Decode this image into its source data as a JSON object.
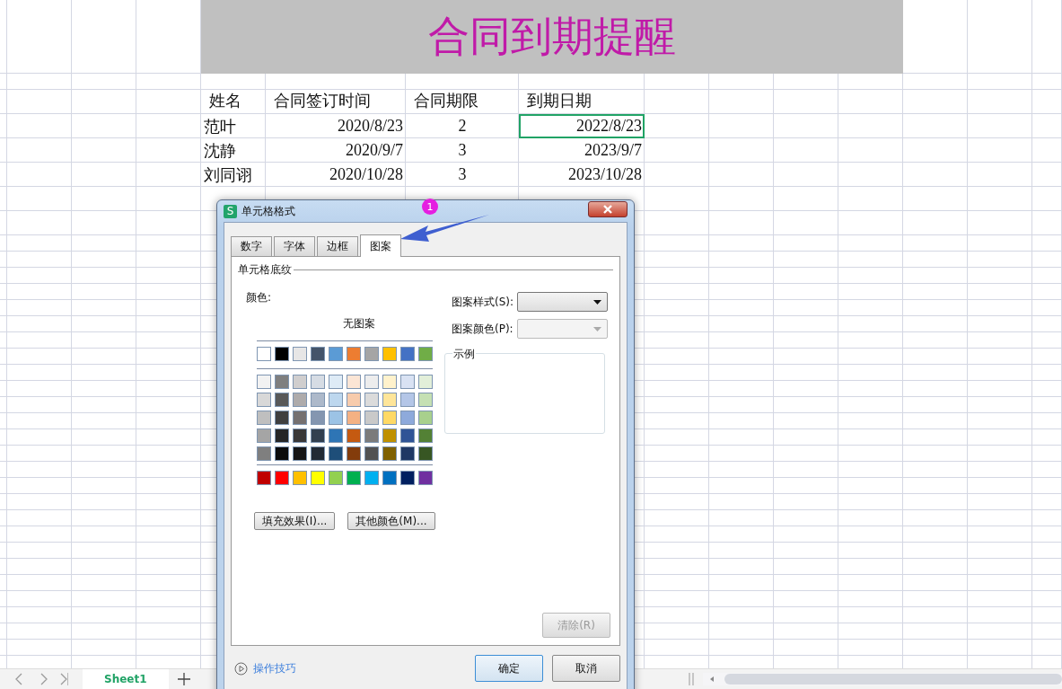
{
  "sheet": {
    "title": "合同到期提醒",
    "columns": [
      "姓名",
      "合同签订时间",
      "合同期限",
      "到期日期"
    ],
    "rows": [
      {
        "cells": [
          {
            "text": "范叶",
            "selected": false
          },
          {
            "text": "2020/8/23",
            "selected": false
          },
          {
            "text": "2",
            "selected": false
          },
          {
            "text": "2022/8/23",
            "selected": true
          }
        ]
      },
      {
        "cells": [
          {
            "text": "沈静",
            "selected": false
          },
          {
            "text": "2020/9/7",
            "selected": false
          },
          {
            "text": "3",
            "selected": false
          },
          {
            "text": "2023/9/7",
            "selected": false
          }
        ]
      },
      {
        "cells": [
          {
            "text": "刘同诩",
            "selected": false
          },
          {
            "text": "2020/10/28",
            "selected": false
          },
          {
            "text": "3",
            "selected": false
          },
          {
            "text": "2023/10/28",
            "selected": false
          }
        ]
      }
    ]
  },
  "sheet_tabs": [
    {
      "label": "Sheet1",
      "selected": true
    }
  ],
  "dialog": {
    "app_icon_letter": "S",
    "title": "单元格格式",
    "tabs": [
      {
        "label": "数字",
        "selected": false
      },
      {
        "label": "字体",
        "selected": false
      },
      {
        "label": "边框",
        "selected": false
      },
      {
        "label": "图案",
        "selected": true
      }
    ],
    "group_title": "单元格底纹",
    "color_label": "颜色:",
    "no_pattern": "无图案",
    "theme_colors": [
      {
        "color": "#ffffff"
      },
      {
        "color": "#000000"
      },
      {
        "color": "#e7e6e6"
      },
      {
        "color": "#44546a"
      },
      {
        "color": "#5b9bd5"
      },
      {
        "color": "#ed7d31"
      },
      {
        "color": "#a5a5a5"
      },
      {
        "color": "#ffc000"
      },
      {
        "color": "#4472c4"
      },
      {
        "color": "#70ad47"
      }
    ],
    "shade_rows": [
      [
        {
          "color": "#f2f2f2"
        },
        {
          "color": "#7f7f7f"
        },
        {
          "color": "#d0cece"
        },
        {
          "color": "#d6dce4"
        },
        {
          "color": "#deebf6"
        },
        {
          "color": "#fbe5d5"
        },
        {
          "color": "#ededed"
        },
        {
          "color": "#fff2cc"
        },
        {
          "color": "#d9e2f3"
        },
        {
          "color": "#e2efd9"
        }
      ],
      [
        {
          "color": "#d8d8d8"
        },
        {
          "color": "#595959"
        },
        {
          "color": "#aeabab"
        },
        {
          "color": "#adb9ca"
        },
        {
          "color": "#bdd7ee"
        },
        {
          "color": "#f7cbac"
        },
        {
          "color": "#dbdbdb"
        },
        {
          "color": "#fee599"
        },
        {
          "color": "#b4c6e7"
        },
        {
          "color": "#c5e0b3"
        }
      ],
      [
        {
          "color": "#bfbfbf"
        },
        {
          "color": "#3f3f3f"
        },
        {
          "color": "#757070"
        },
        {
          "color": "#8496b0"
        },
        {
          "color": "#9cc3e5"
        },
        {
          "color": "#f4b183"
        },
        {
          "color": "#c9c9c9"
        },
        {
          "color": "#ffd965"
        },
        {
          "color": "#8eaadb"
        },
        {
          "color": "#a8d08d"
        }
      ],
      [
        {
          "color": "#a5a5a5"
        },
        {
          "color": "#262626"
        },
        {
          "color": "#3a3838"
        },
        {
          "color": "#323f4f"
        },
        {
          "color": "#2e75b5"
        },
        {
          "color": "#c55a11"
        },
        {
          "color": "#7b7b7b"
        },
        {
          "color": "#bf9000"
        },
        {
          "color": "#2f5496"
        },
        {
          "color": "#538135"
        }
      ],
      [
        {
          "color": "#7f7f7f"
        },
        {
          "color": "#0c0c0c"
        },
        {
          "color": "#171616"
        },
        {
          "color": "#222a35"
        },
        {
          "color": "#1e4e79"
        },
        {
          "color": "#833c0b"
        },
        {
          "color": "#525252"
        },
        {
          "color": "#7f6000"
        },
        {
          "color": "#1f3864"
        },
        {
          "color": "#375623"
        }
      ]
    ],
    "standard_colors": [
      {
        "color": "#c00000"
      },
      {
        "color": "#ff0000"
      },
      {
        "color": "#ffc000"
      },
      {
        "color": "#ffff00"
      },
      {
        "color": "#92d050"
      },
      {
        "color": "#00b050"
      },
      {
        "color": "#00b0f0"
      },
      {
        "color": "#0070c0"
      },
      {
        "color": "#002060"
      },
      {
        "color": "#7030a0"
      }
    ],
    "fill_effects_button": "填充效果(I)...",
    "more_colors_button": "其他颜色(M)...",
    "pattern_style": {
      "label": "图案样式(S):",
      "disabled": false
    },
    "pattern_color": {
      "label": "图案颜色(P):",
      "disabled": true
    },
    "sample_label": "示例",
    "clear_button": {
      "label": "清除(R)",
      "disabled": true
    },
    "tips_link": "操作技巧",
    "ok_button": "确定",
    "cancel_button": "取消"
  },
  "annotation": {
    "badge": "1"
  }
}
